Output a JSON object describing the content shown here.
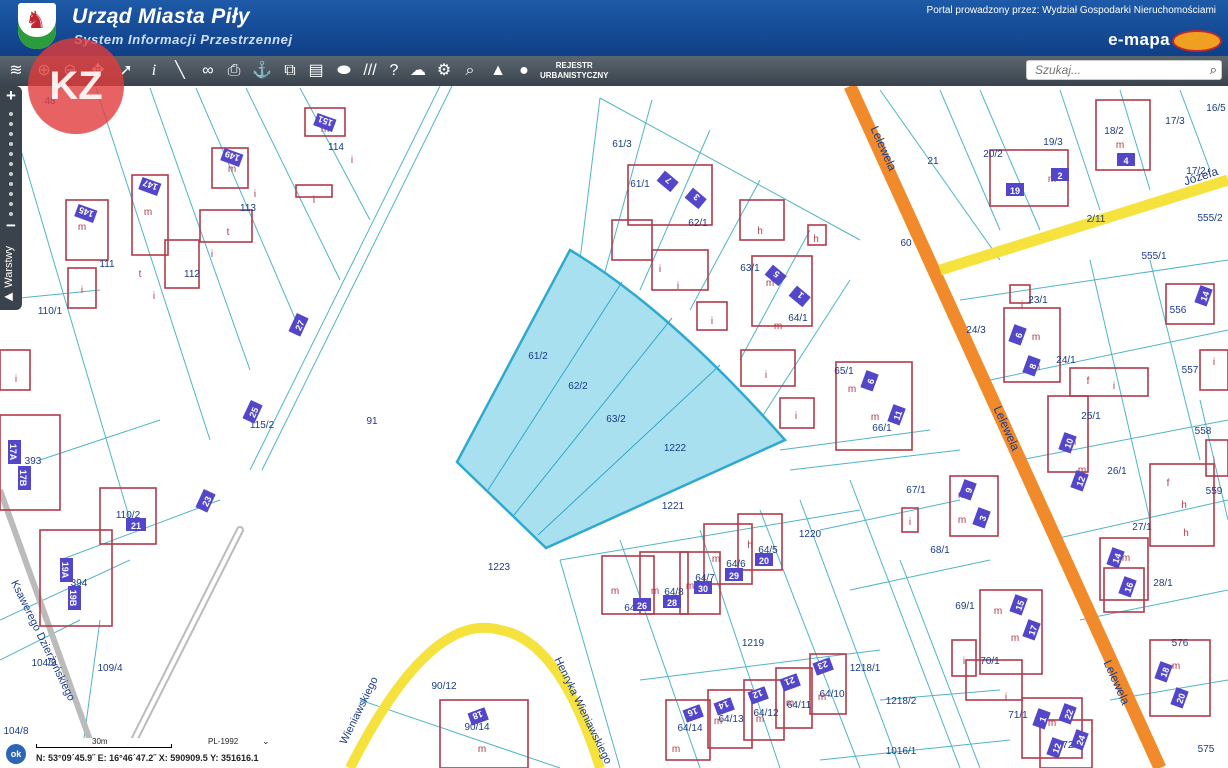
{
  "header": {
    "title": "Urząd Miasta Piły",
    "subtitle": "System Informacji Przestrzennej",
    "portal_text": "Portal prowadzony przez: Wydział Gospodarki Nieruchomościami",
    "brand": "e-mapa"
  },
  "toolbar": {
    "rejestr_line1": "REJESTR",
    "rejestr_line2": "URBANISTYCZNY",
    "search_placeholder": "Szukaj...",
    "icons": [
      "layers-icon",
      "zoom-in-icon",
      "zoom-out-icon",
      "pan-icon",
      "info-icon",
      "measure-icon",
      "link-icon",
      "print-icon",
      "locate-icon",
      "export-icon",
      "layout-icon",
      "shape-icon",
      "hatch-icon",
      "help-icon",
      "cloud-icon",
      "settings-icon",
      "search-map-icon",
      "mountain-icon",
      "user-icon"
    ]
  },
  "sidebar": {
    "zoom_in": "+",
    "zoom_out": "−",
    "layers_label": "Warstwy"
  },
  "watermark": "KZ",
  "map": {
    "parcel_labels": [
      "61/3",
      "61/1",
      "62/1",
      "63/1",
      "64/1",
      "65/1",
      "66/1",
      "67/1",
      "68/1",
      "69/1",
      "70/1",
      "71/1",
      "72/1",
      "21",
      "20/2",
      "19/3",
      "18/2",
      "17/3",
      "16/5",
      "17/2",
      "2/11",
      "555/2",
      "555/1",
      "556",
      "557",
      "558",
      "559",
      "23/1",
      "24/1",
      "24/3",
      "25/1",
      "26/1",
      "27/1",
      "28/1",
      "576",
      "575",
      "60",
      "91",
      "61/2",
      "62/2",
      "63/2",
      "1222",
      "1221",
      "1220",
      "1223",
      "1219",
      "1218/1",
      "1218/2",
      "1016/1",
      "64/14",
      "64/13",
      "64/12",
      "64/11",
      "64/10",
      "64/9",
      "64/8",
      "64/7",
      "64/6",
      "64/5",
      "114",
      "113",
      "112",
      "111",
      "110/1",
      "110/2",
      "115/2",
      "104/9",
      "109/4",
      "104/8",
      "90/12",
      "90/14",
      "394",
      "393",
      "48"
    ],
    "building_letters": [
      "m",
      "i",
      "t",
      "h",
      "f"
    ],
    "house_numbers": [
      "151",
      "149",
      "147",
      "145",
      "27",
      "25",
      "23",
      "21",
      "19A",
      "19B",
      "17A",
      "17B",
      "7",
      "3",
      "5",
      "1",
      "6",
      "11",
      "9",
      "3",
      "15",
      "17",
      "19",
      "2",
      "4",
      "6",
      "8",
      "10",
      "12",
      "14",
      "16",
      "18",
      "20",
      "22",
      "24",
      "26",
      "28",
      "30",
      "29",
      "20",
      "18",
      "16",
      "14",
      "12",
      "21",
      "23",
      "1",
      "12",
      "14",
      "16",
      "18",
      "1",
      "4"
    ],
    "street_names": [
      "Lelewela",
      "Lelewela",
      "Lelewela",
      "Józefa",
      "Ksawerego Dzierżyńskiego",
      "Henryka Wieniawskiego",
      "Wieniawskiego"
    ],
    "colors": {
      "parcel_line": "#4fb5c6",
      "building_outline": "#b23a4a",
      "house_number_fill": "#5346c9",
      "highlight_fill": "#a9e0ef",
      "highlight_stroke": "#2ea9cf",
      "main_road": "#f08a2a",
      "minor_road": "#f5e23c"
    }
  },
  "status": {
    "scale": "30m",
    "crs": "PL-1992",
    "coordinates": "N: 53°09´45.9˝  E: 16°46´47.2˝  X: 590909.5  Y: 351616.1",
    "ok": "ok"
  }
}
